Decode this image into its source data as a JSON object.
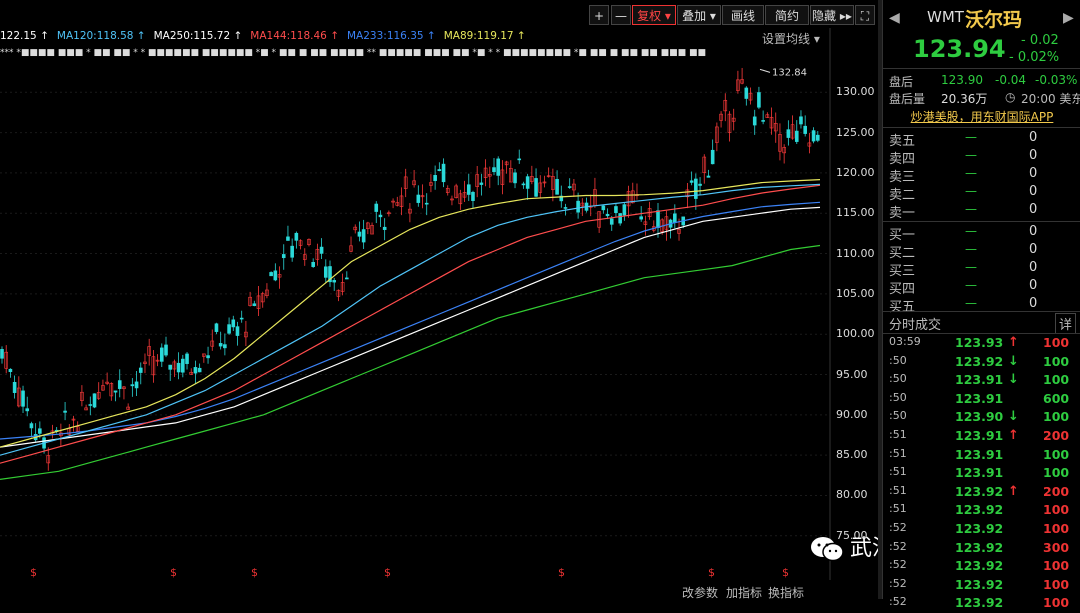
{
  "toolbar": {
    "plus": "+",
    "minus": "—",
    "fuquan": "复权",
    "diejia": "叠加",
    "huaxian": "画线",
    "jianyue": "简约",
    "yincang": "隐藏",
    "fullscreen": "⛶"
  },
  "ma_legend": [
    {
      "label": "122.15",
      "arrow": "↑",
      "color": "#ffffff"
    },
    {
      "label": "MA120:118.58",
      "arrow": "↑",
      "color": "#4fc3f7"
    },
    {
      "label": "MA250:115.72",
      "arrow": "↑",
      "color": "#ffffff"
    },
    {
      "label": "MA144:118.46",
      "arrow": "↑",
      "color": "#ff4d4d"
    },
    {
      "label": "MA233:116.35",
      "arrow": "↑",
      "color": "#3b82f6"
    },
    {
      "label": "MA89:119.17",
      "arrow": "↑",
      "color": "#e6e65c"
    }
  ],
  "set_ma": "设置均线",
  "high_label": "132.84",
  "news_marks": "*** *■■■■ ■■■ * ■■ ■■ * * ■■■■■■ ■■■■■■ *■ * ■■ ■ ■■ ■■■■ ** ■■■■■ ■■■ ■■ *■ * * ■■■■■■■■ *■ ■■ ■ ■■ ■■ ■■■ ■■",
  "dollar_mark": "$",
  "bottom_buttons": [
    "改参数",
    "加指标",
    "换指标"
  ],
  "watermark": "武汉刘正涛投资",
  "side": {
    "symbol": "WMT",
    "name": "沃尔玛",
    "price": "123.94",
    "change": "- 0.02",
    "change_pct": "- 0.02%",
    "after_label": "盘后",
    "after_price": "123.90",
    "after_chg": "-0.04",
    "after_pct": "-0.03%",
    "after_vol_label": "盘后量",
    "after_vol": "20.36万",
    "time": "20:00 美东",
    "ad": "炒港美股，用东财国际APP",
    "asks": [
      {
        "label": "卖五",
        "price": "—",
        "vol": "0"
      },
      {
        "label": "卖四",
        "price": "—",
        "vol": "0"
      },
      {
        "label": "卖三",
        "price": "—",
        "vol": "0"
      },
      {
        "label": "卖二",
        "price": "—",
        "vol": "0"
      },
      {
        "label": "卖一",
        "price": "—",
        "vol": "0"
      }
    ],
    "bids": [
      {
        "label": "买一",
        "price": "—",
        "vol": "0"
      },
      {
        "label": "买二",
        "price": "—",
        "vol": "0"
      },
      {
        "label": "买三",
        "price": "—",
        "vol": "0"
      },
      {
        "label": "买四",
        "price": "—",
        "vol": "0"
      },
      {
        "label": "买五",
        "price": "—",
        "vol": "0"
      }
    ],
    "trades_title": "分时成交",
    "trades_detail": "详",
    "trades": [
      {
        "t": "03:59",
        "p": "123.93",
        "d": "↑",
        "v": "100",
        "dir": "up"
      },
      {
        "t": ":50",
        "p": "123.92",
        "d": "↓",
        "v": "100",
        "dir": "dn"
      },
      {
        "t": ":50",
        "p": "123.91",
        "d": "↓",
        "v": "100",
        "dir": "dn"
      },
      {
        "t": ":50",
        "p": "123.91",
        "d": "",
        "v": "600",
        "dir": "dn"
      },
      {
        "t": ":50",
        "p": "123.90",
        "d": "↓",
        "v": "100",
        "dir": "dn"
      },
      {
        "t": ":51",
        "p": "123.91",
        "d": "↑",
        "v": "200",
        "dir": "up"
      },
      {
        "t": ":51",
        "p": "123.91",
        "d": "",
        "v": "100",
        "dir": "dn"
      },
      {
        "t": ":51",
        "p": "123.91",
        "d": "",
        "v": "100",
        "dir": "dn"
      },
      {
        "t": ":51",
        "p": "123.92",
        "d": "↑",
        "v": "200",
        "dir": "up"
      },
      {
        "t": ":51",
        "p": "123.92",
        "d": "",
        "v": "100",
        "dir": "up"
      },
      {
        "t": ":52",
        "p": "123.92",
        "d": "",
        "v": "100",
        "dir": "up"
      },
      {
        "t": ":52",
        "p": "123.92",
        "d": "",
        "v": "300",
        "dir": "up"
      },
      {
        "t": ":52",
        "p": "123.92",
        "d": "",
        "v": "100",
        "dir": "up"
      },
      {
        "t": ":52",
        "p": "123.92",
        "d": "",
        "v": "100",
        "dir": "up"
      },
      {
        "t": ":52",
        "p": "123.92",
        "d": "",
        "v": "100",
        "dir": "up"
      }
    ]
  },
  "chart_data": {
    "type": "line",
    "y_ticks": [
      "130.00",
      "125.00",
      "120.00",
      "115.00",
      "110.00",
      "105.00",
      "100.00",
      "95.00",
      "90.00",
      "85.00",
      "80.00",
      "75.00"
    ],
    "ylim": [
      72,
      134
    ],
    "series": [
      {
        "name": "MA250",
        "color": "#ffffff",
        "values": [
          86,
          86.5,
          87,
          87.5,
          88,
          88.5,
          89,
          90,
          91,
          92.5,
          94,
          95.5,
          97,
          98.5,
          100,
          101.5,
          103,
          104.5,
          106,
          107.5,
          109,
          110.5,
          112,
          113,
          114,
          114.5,
          115,
          115.5,
          115.72
        ]
      },
      {
        "name": "MA233",
        "color": "#3b82f6",
        "values": [
          87,
          87.3,
          87.6,
          88,
          88.5,
          89,
          89.8,
          90.8,
          92,
          93.5,
          95,
          96.5,
          98,
          99.5,
          101,
          102.5,
          104,
          105.5,
          107,
          108.5,
          110,
          111.5,
          112.8,
          113.8,
          114.6,
          115.2,
          115.8,
          116.1,
          116.35
        ]
      },
      {
        "name": "MA144",
        "color": "#ff4d4d",
        "values": [
          84,
          85,
          86,
          87,
          88,
          89,
          90,
          91.5,
          93,
          95,
          97,
          99,
          101,
          103,
          105,
          107,
          109,
          110.5,
          112,
          113,
          114,
          114.5,
          115,
          115.5,
          116,
          116.8,
          117.5,
          118,
          118.46
        ]
      },
      {
        "name": "MA120",
        "color": "#4fc3f7",
        "values": [
          85,
          86,
          87,
          88,
          89,
          90,
          91.5,
          93,
          95,
          97,
          99,
          101,
          103.5,
          106,
          108,
          110,
          112,
          113.5,
          114.5,
          115.2,
          115.8,
          116.2,
          116.6,
          117,
          117.3,
          117.8,
          118.2,
          118.4,
          118.58
        ]
      },
      {
        "name": "MA89",
        "color": "#e6e65c",
        "values": [
          86,
          87,
          88,
          89,
          90,
          91,
          92.5,
          94.5,
          97,
          100,
          103,
          106,
          109,
          111,
          113,
          114.5,
          115.5,
          116.2,
          116.8,
          117,
          117.2,
          117.2,
          117.3,
          117.5,
          117.8,
          118.3,
          118.8,
          119,
          119.17
        ]
      },
      {
        "name": "",
        "color": "#33cc33",
        "values": [
          82,
          82.5,
          83,
          84,
          85,
          86,
          87,
          88,
          89,
          90,
          91.5,
          93,
          94.5,
          96,
          97.5,
          99,
          100.5,
          102,
          103,
          104,
          105,
          106,
          107,
          107.5,
          108,
          108.5,
          109.5,
          110.5,
          111
        ]
      }
    ],
    "high_value": 132.84
  }
}
